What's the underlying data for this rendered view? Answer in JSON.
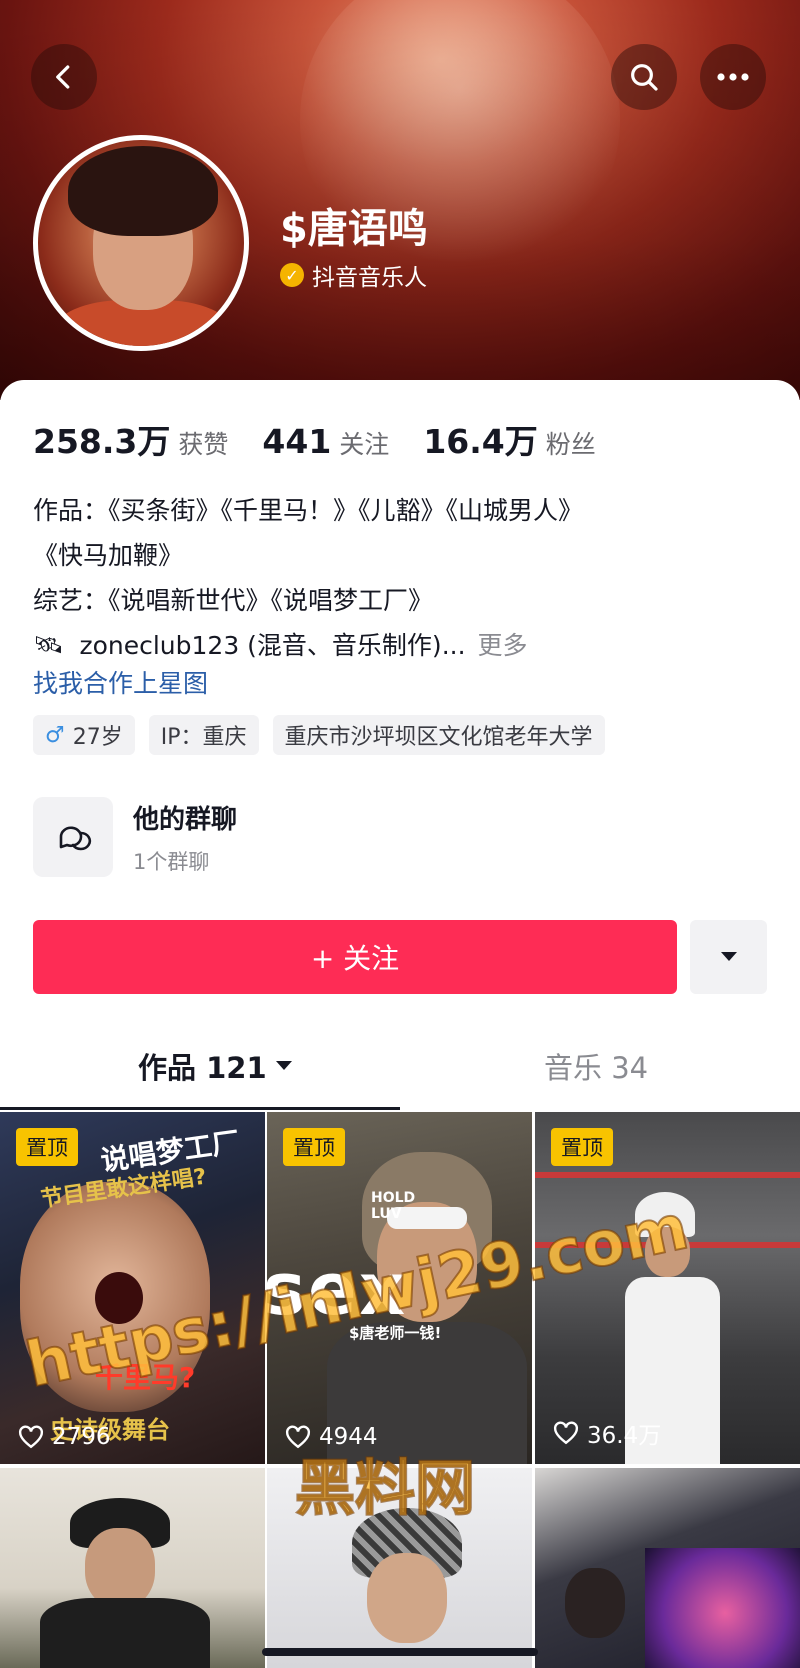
{
  "profile": {
    "name": "$唐语鸣",
    "verified_label": "抖音音乐人"
  },
  "stats": [
    {
      "value": "258.3万",
      "label": "获赞"
    },
    {
      "value": "441",
      "label": "关注"
    },
    {
      "value": "16.4万",
      "label": "粉丝"
    }
  ],
  "bio": {
    "line1": "作品：《买条街》《千里马！》《儿豁》《山城男人》",
    "line2": "《快马加鞭》",
    "line3": "综艺：《说唱新世代》《说唱梦工厂》",
    "line4": "zoneclub123 (混音、音乐制作)...",
    "more": "更多"
  },
  "link_text": "找我合作上星图",
  "tags": {
    "age": "27岁",
    "ip": "IP：重庆",
    "location": "重庆市沙坪坝区文化馆老年大学"
  },
  "group": {
    "title": "他的群聊",
    "subtitle": "1个群聊"
  },
  "follow_label": "+ 关注",
  "tabs": {
    "works": "作品 121",
    "music": "音乐 34"
  },
  "videos": [
    {
      "pin": "置顶",
      "likes": "2796",
      "overlay_top": "说唱梦工厂",
      "overlay_sub": "节目里敢这样唱?",
      "overlay_mid": "千里马?",
      "overlay_bottom": "史诗级舞台"
    },
    {
      "pin": "置顶",
      "likes": "4944",
      "overlay_top": "HOLD LUV",
      "overlay_mid": "sex",
      "overlay_bottom": "$唐老师一钱!"
    },
    {
      "pin": "置顶",
      "likes": "36.4万"
    },
    {},
    {},
    {}
  ],
  "watermark": {
    "url": "https://inlwj29.com",
    "text": "黑料网"
  },
  "colors": {
    "accent": "#fe2c55",
    "pin": "#f8c300",
    "link": "#2b5ea8"
  },
  "icons": [
    "back-icon",
    "search-icon",
    "more-icon",
    "verified-icon",
    "chat-bubbles-icon",
    "chevron-down-icon",
    "heart-icon",
    "male-icon"
  ]
}
